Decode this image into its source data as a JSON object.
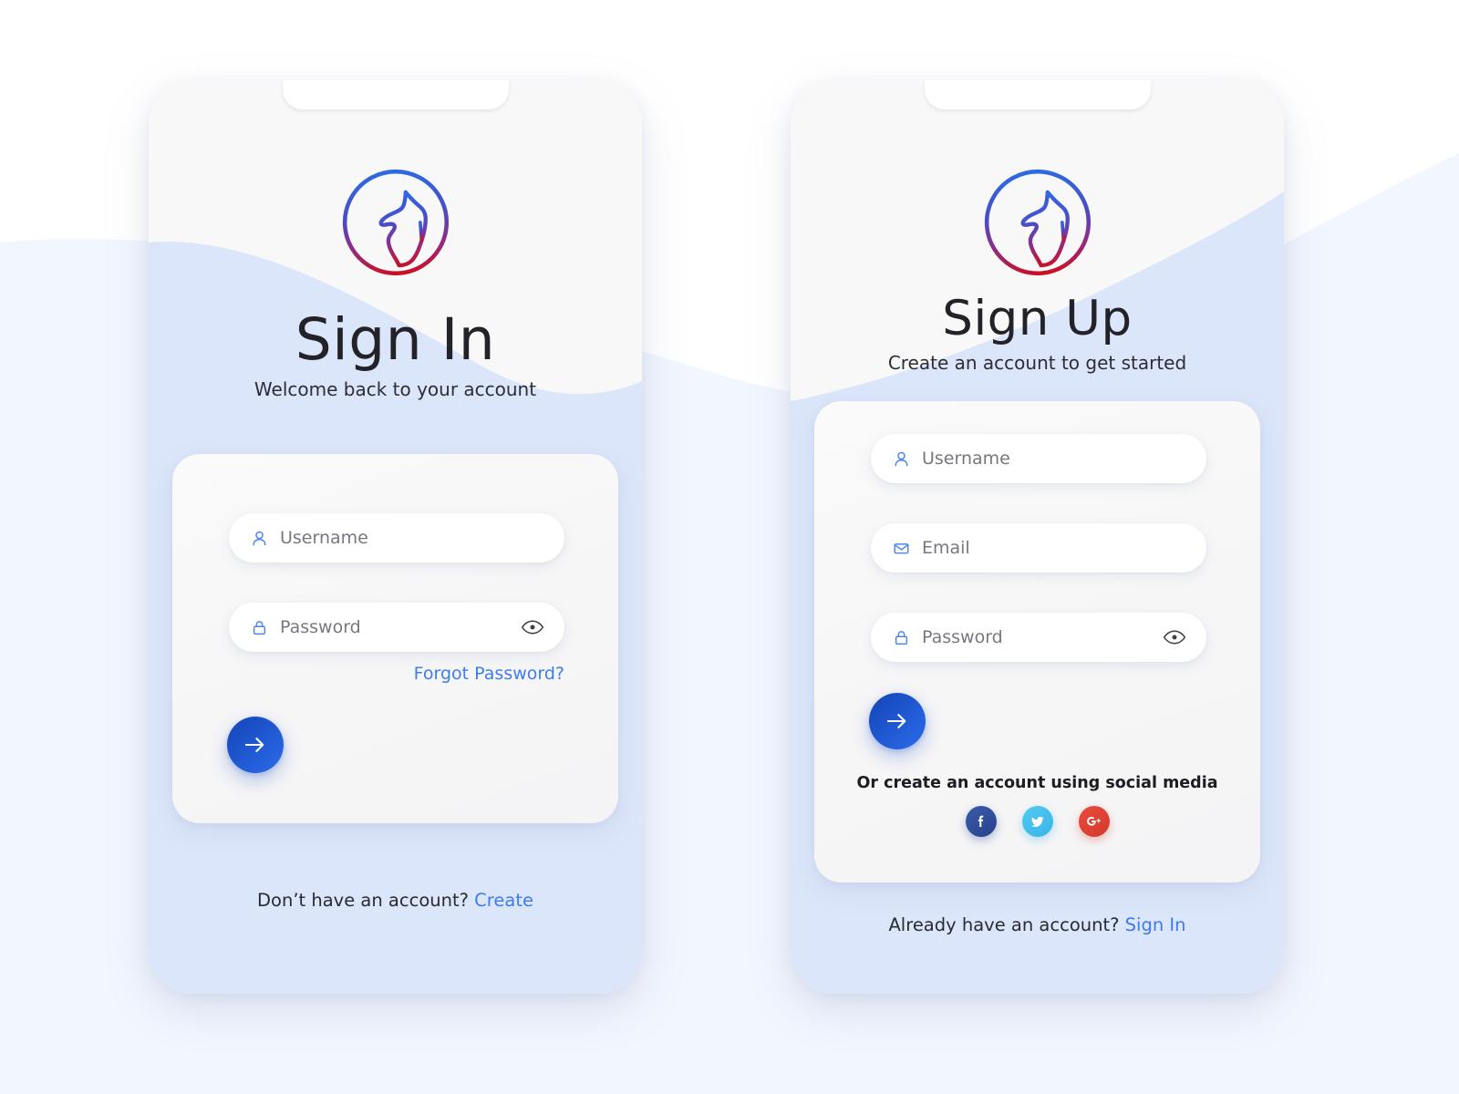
{
  "page": {
    "background_color": "#ffffff",
    "wave_color_outside": "#f2f6fe",
    "wave_color_inside": "#dce6fa",
    "accent_blue": "#3d7bef",
    "button_gradient_from": "#1544b4",
    "button_gradient_to": "#2a6ce9"
  },
  "logo": {
    "name": "wolf-circle-logo",
    "gradient_top": "#2d6ae3",
    "gradient_mid": "#6a3ab0",
    "gradient_bottom": "#c81226"
  },
  "signin": {
    "title": "Sign In",
    "subtitle": "Welcome back to your account",
    "fields": [
      {
        "icon": "user-icon",
        "placeholder": "Username",
        "value": "",
        "has_eye": false
      },
      {
        "icon": "lock-icon",
        "placeholder": "Password",
        "value": "",
        "has_eye": true
      }
    ],
    "forgot_label": "Forgot Password?",
    "submit_icon": "arrow-right-icon",
    "footer_text": "Don’t have an account? ",
    "footer_link": "Create"
  },
  "signup": {
    "title": "Sign Up",
    "subtitle": "Create an account to get started",
    "fields": [
      {
        "icon": "user-icon",
        "placeholder": "Username",
        "value": "",
        "has_eye": false
      },
      {
        "icon": "mail-icon",
        "placeholder": "Email",
        "value": "",
        "has_eye": false
      },
      {
        "icon": "lock-icon",
        "placeholder": "Password",
        "value": "",
        "has_eye": true
      }
    ],
    "submit_icon": "arrow-right-icon",
    "social_text": "Or create an account using social media",
    "social_buttons": [
      {
        "name": "facebook",
        "glyph": "f",
        "color": "#3b5ca8"
      },
      {
        "name": "twitter",
        "glyph": "",
        "color": "#55c8f2"
      },
      {
        "name": "google-plus",
        "glyph": "G+",
        "color": "#ea4b3d"
      }
    ],
    "footer_text": "Already have an account? ",
    "footer_link": "Sign In"
  }
}
